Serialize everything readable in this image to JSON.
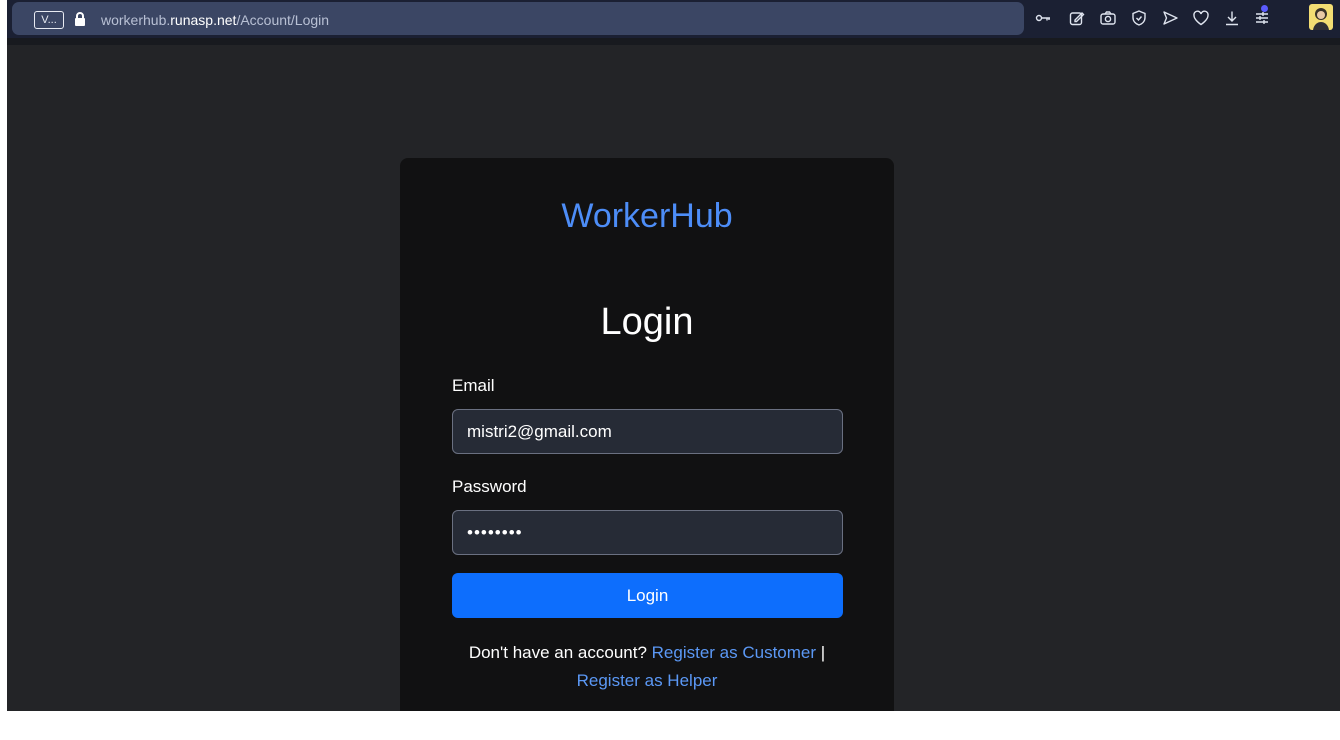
{
  "browser": {
    "tab_badge": "V...",
    "url_prefix": "workerhub.",
    "url_domain": "runasp.net",
    "url_path": "/Account/Login",
    "toolbar_icons": [
      "key-icon",
      "edit-icon",
      "camera-icon",
      "shield-icon",
      "send-icon",
      "heart-icon",
      "download-icon",
      "menu-icon",
      "avatar"
    ]
  },
  "page": {
    "brand": "WorkerHub",
    "title": "Login",
    "email": {
      "label": "Email",
      "value": "mistri2@gmail.com"
    },
    "password": {
      "label": "Password",
      "value": "••••••••"
    },
    "submit_label": "Login",
    "footer": {
      "prompt": "Don't have an account?",
      "customer_link": "Register as Customer",
      "separator": "|",
      "helper_link": "Register as Helper"
    }
  },
  "colors": {
    "brand": "#4d8df7",
    "link": "#5b98f5",
    "button": "#0d6efd",
    "background": "#232427",
    "card": "#111112"
  }
}
